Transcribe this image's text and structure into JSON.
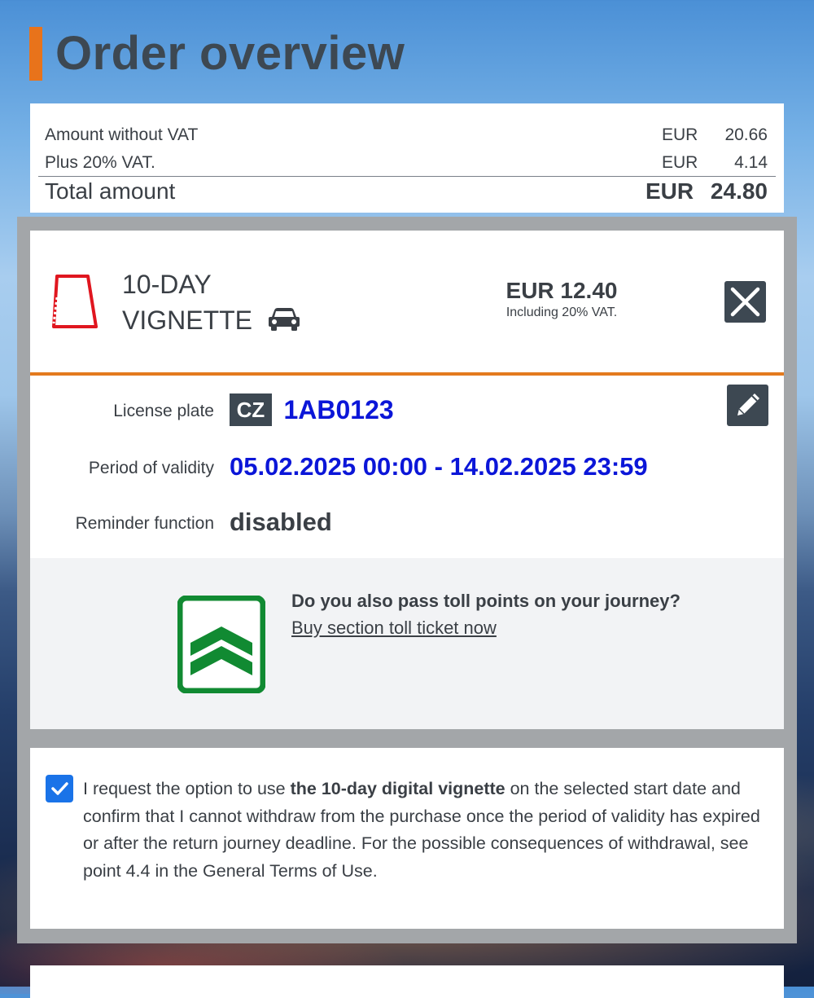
{
  "page": {
    "title": "Order overview"
  },
  "totals": {
    "rows": [
      {
        "label": "Amount without VAT",
        "currency": "EUR",
        "amount": "20.66"
      },
      {
        "label": "Plus 20% VAT.",
        "currency": "EUR",
        "amount": "4.14"
      }
    ],
    "total": {
      "label": "Total amount",
      "currency": "EUR",
      "amount": "24.80"
    }
  },
  "product": {
    "name_line1": "10-DAY",
    "name_line2": "VIGNETTE",
    "vehicle_icon": "car-icon",
    "price": "EUR 12.40",
    "price_note": "Including 20% VAT.",
    "remove_icon": "close-icon",
    "edit_icon": "pencil-icon",
    "license_plate_label": "License plate",
    "country_code": "CZ",
    "license_plate": "1AB0123",
    "validity_label": "Period of validity",
    "validity": "05.02.2025 00:00 - 14.02.2025 23:59",
    "reminder_label": "Reminder function",
    "reminder": "disabled"
  },
  "upsell": {
    "question": "Do you also pass toll points on your journey?",
    "link": "Buy section toll ticket now"
  },
  "consent": {
    "checked": true,
    "text_before": "I request the option to use ",
    "text_bold": "the 10-day digital vignette",
    "text_after": " on the selected start date and confirm that I cannot withdraw from the purchase once the period of validity has expired or after the return journey deadline. For the possible consequences of withdrawal, see point 4.4 in the General Terms of Use."
  },
  "colors": {
    "accent": "#e37a1e",
    "plate_text": "#0b16d8",
    "dark": "#3d4852",
    "toll_green": "#118a32",
    "vignette_red": "#e0161f",
    "checkbox_blue": "#1a73e8"
  }
}
